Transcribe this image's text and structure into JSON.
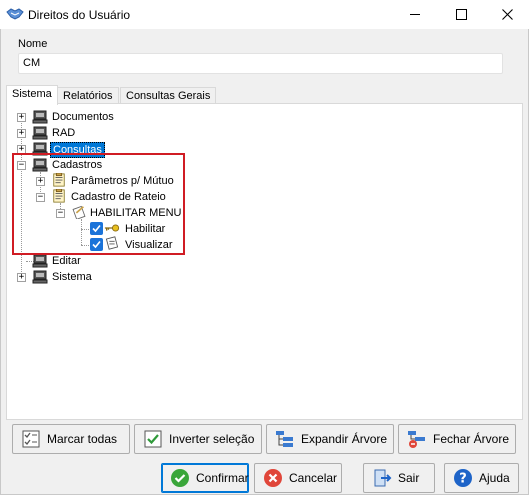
{
  "window": {
    "title": "Direitos do Usuário"
  },
  "form": {
    "name_label": "Nome",
    "name_value": "CM"
  },
  "tabs": [
    {
      "label": "Sistema",
      "active": true
    },
    {
      "label": "Relatórios",
      "active": false
    },
    {
      "label": "Consultas Gerais",
      "active": false
    }
  ],
  "tree": {
    "nodes": [
      {
        "label": "Documentos",
        "icon": "computer-icon",
        "expander": "+"
      },
      {
        "label": "RAD",
        "icon": "computer-icon",
        "expander": "+"
      },
      {
        "label": "Consultas",
        "icon": "computer-icon",
        "expander": "+",
        "selected": true
      },
      {
        "label": "Cadastros",
        "icon": "computer-icon",
        "expander": "-"
      },
      {
        "label": "Parâmetros p/ Mútuo",
        "icon": "document-icon",
        "expander": "+"
      },
      {
        "label": "Cadastro de Rateio",
        "icon": "document-icon",
        "expander": "-"
      },
      {
        "label": "HABILITAR MENU",
        "icon": "pencil-document-icon",
        "expander": "-"
      },
      {
        "label": "Habilitar",
        "icon": "key-icon",
        "checked": true
      },
      {
        "label": "Visualizar",
        "icon": "view-document-icon",
        "checked": true
      },
      {
        "label": "Editar",
        "icon": "computer-icon",
        "expander": "+"
      },
      {
        "label": "Sistema",
        "icon": "computer-icon",
        "expander": "+"
      }
    ]
  },
  "tree_buttons": {
    "mark_all": "Marcar todas",
    "invert": "Inverter seleção",
    "expand": "Expandir Árvore",
    "collapse": "Fechar Árvore"
  },
  "footer_buttons": {
    "confirm": "Confirmar",
    "cancel": "Cancelar",
    "exit": "Sair",
    "help": "Ajuda"
  },
  "colors": {
    "selection": "#0078d7",
    "highlight_box": "#d01c24",
    "checkbox": "#1a73d9",
    "confirm_icon": "#3aa63a",
    "cancel_icon": "#e0463a",
    "help_icon": "#1e64c8"
  }
}
